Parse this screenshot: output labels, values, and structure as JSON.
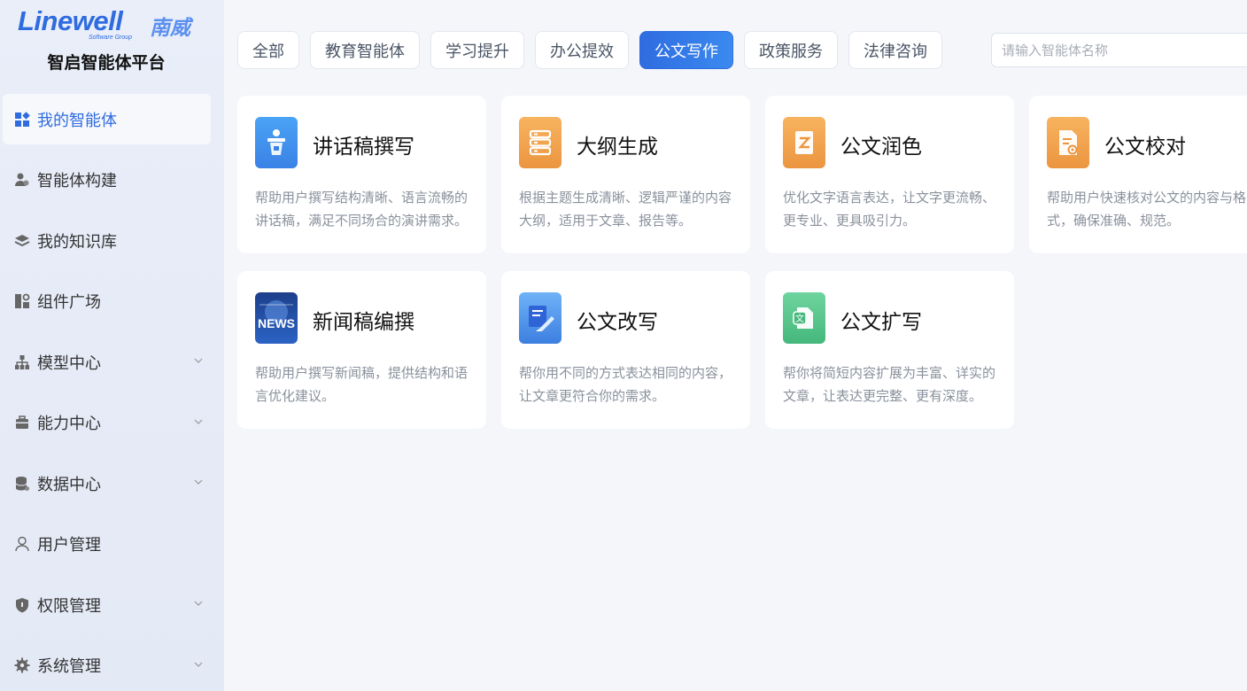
{
  "brand": {
    "logo_en": "Linewell",
    "logo_sub": "Software Group",
    "logo_cn": "南威",
    "platform_name": "智启智能体平台",
    "accent_color": "#2f6ce0"
  },
  "sidebar": {
    "items": [
      {
        "label": "我的智能体",
        "icon": "grid-icon",
        "active": true,
        "expandable": false
      },
      {
        "label": "智能体构建",
        "icon": "users-icon",
        "active": false,
        "expandable": false
      },
      {
        "label": "我的知识库",
        "icon": "layers-icon",
        "active": false,
        "expandable": false
      },
      {
        "label": "组件广场",
        "icon": "components-icon",
        "active": false,
        "expandable": false
      },
      {
        "label": "模型中心",
        "icon": "hierarchy-icon",
        "active": false,
        "expandable": true
      },
      {
        "label": "能力中心",
        "icon": "toolbox-icon",
        "active": false,
        "expandable": true
      },
      {
        "label": "数据中心",
        "icon": "database-icon",
        "active": false,
        "expandable": true
      },
      {
        "label": "用户管理",
        "icon": "user-icon",
        "active": false,
        "expandable": false
      },
      {
        "label": "权限管理",
        "icon": "shield-icon",
        "active": false,
        "expandable": true
      },
      {
        "label": "系统管理",
        "icon": "gear-icon",
        "active": false,
        "expandable": true
      }
    ]
  },
  "tabs": [
    {
      "label": "全部",
      "active": false
    },
    {
      "label": "教育智能体",
      "active": false
    },
    {
      "label": "学习提升",
      "active": false
    },
    {
      "label": "办公提效",
      "active": false
    },
    {
      "label": "公文写作",
      "active": true
    },
    {
      "label": "政策服务",
      "active": false
    },
    {
      "label": "法律咨询",
      "active": false
    }
  ],
  "search": {
    "placeholder": "请输入智能体名称"
  },
  "cards": [
    {
      "title": "讲话稿撰写",
      "desc": "帮助用户撰写结构清晰、语言流畅的讲话稿，满足不同场合的演讲需求。",
      "icon": "speech-podium-icon",
      "color": "#3d8ff0"
    },
    {
      "title": "大纲生成",
      "desc": "根据主题生成清晰、逻辑严谨的内容大纲，适用于文章、报告等。",
      "icon": "outline-list-icon",
      "color": "#f0a24a"
    },
    {
      "title": "公文润色",
      "desc": "优化文字语言表达，让文字更流畅、更专业、更具吸引力。",
      "icon": "polish-document-icon",
      "color": "#f0a24a"
    },
    {
      "title": "公文校对",
      "desc": "帮助用户快速核对公文的内容与格式，确保准确、规范。",
      "icon": "proofread-document-icon",
      "color": "#f0a24a"
    },
    {
      "title": "新闻稿编撰",
      "desc": "帮助用户撰写新闻稿，提供结构和语言优化建议。",
      "icon": "news-icon",
      "color": "#2a5cb8"
    },
    {
      "title": "公文改写",
      "desc": "帮你用不同的方式表达相同的内容，让文章更符合你的需求。",
      "icon": "rewrite-document-icon",
      "color": "#4a90e8"
    },
    {
      "title": "公文扩写",
      "desc": "帮你将简短内容扩展为丰富、详实的文章，让表达更完整、更有深度。",
      "icon": "expand-document-icon",
      "color": "#52c48a"
    }
  ]
}
